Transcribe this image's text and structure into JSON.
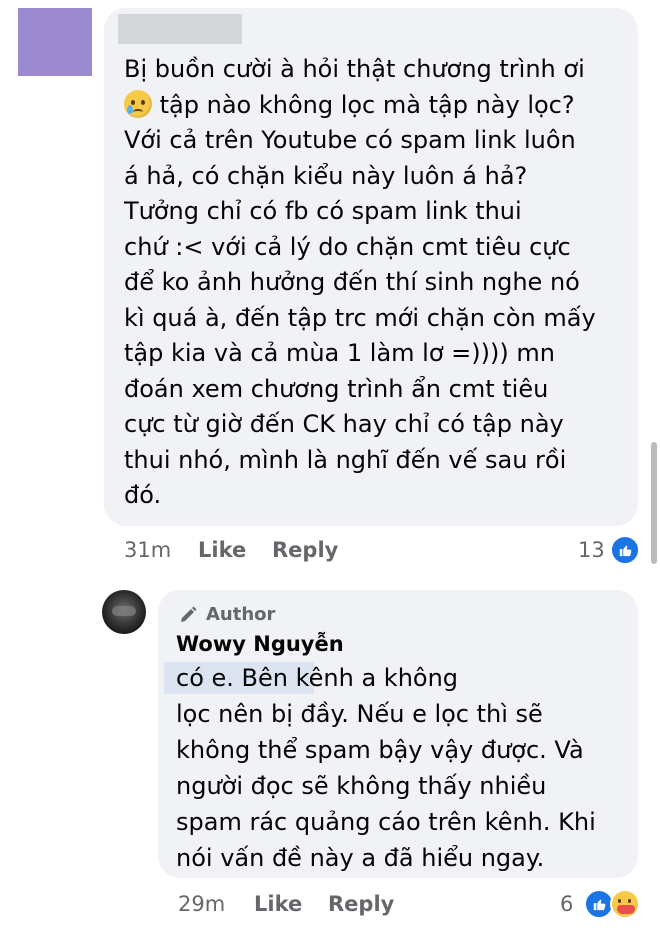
{
  "comment": {
    "text_before_emoji": "Bị buồn cười à hỏi thật chương trình ơi\n",
    "text_after_emoji": " tập nào không lọc mà tập này lọc?\nVới cả trên Youtube có spam link luôn\ná hả, có chặn kiểu này luôn á hả?\nTưởng chỉ có fb có spam link thui\nchứ :< với cả lý do chặn cmt tiêu cực\nđể ko ảnh hưởng đến thí sinh nghe nó\nkì quá à, đến tập trc mới chặn còn mấy\ntập kia và cả mùa 1 làm lơ =)))) mn\nđoán xem chương trình ẩn cmt tiêu\ncực từ giờ đến CK hay chỉ có tập này\nthui nhó, mình là nghĩ đến vế sau rồi\nđó.",
    "emoji": "crying-face-emoji",
    "time": "31m",
    "like_label": "Like",
    "reply_label": "Reply",
    "reaction_count": "13"
  },
  "reply": {
    "author_badge": "Author",
    "author_name": "Wowy Nguyễn",
    "text": "                   có e. Bên kênh a không\nlọc nên bị đầy. Nếu e lọc thì sẽ\nkhông thể spam bậy vậy được. Và\nngười đọc sẽ không thấy nhiều\nspam rác quảng cáo trên kênh. Khi\nnói vấn đề này a đã hiểu ngay.",
    "time": "29m",
    "like_label": "Like",
    "reply_label": "Reply",
    "reaction_count": "6"
  },
  "colors": {
    "bubble": "#f0f2f5",
    "meta_text": "#65676b",
    "like_blue": "#1b74e4"
  }
}
